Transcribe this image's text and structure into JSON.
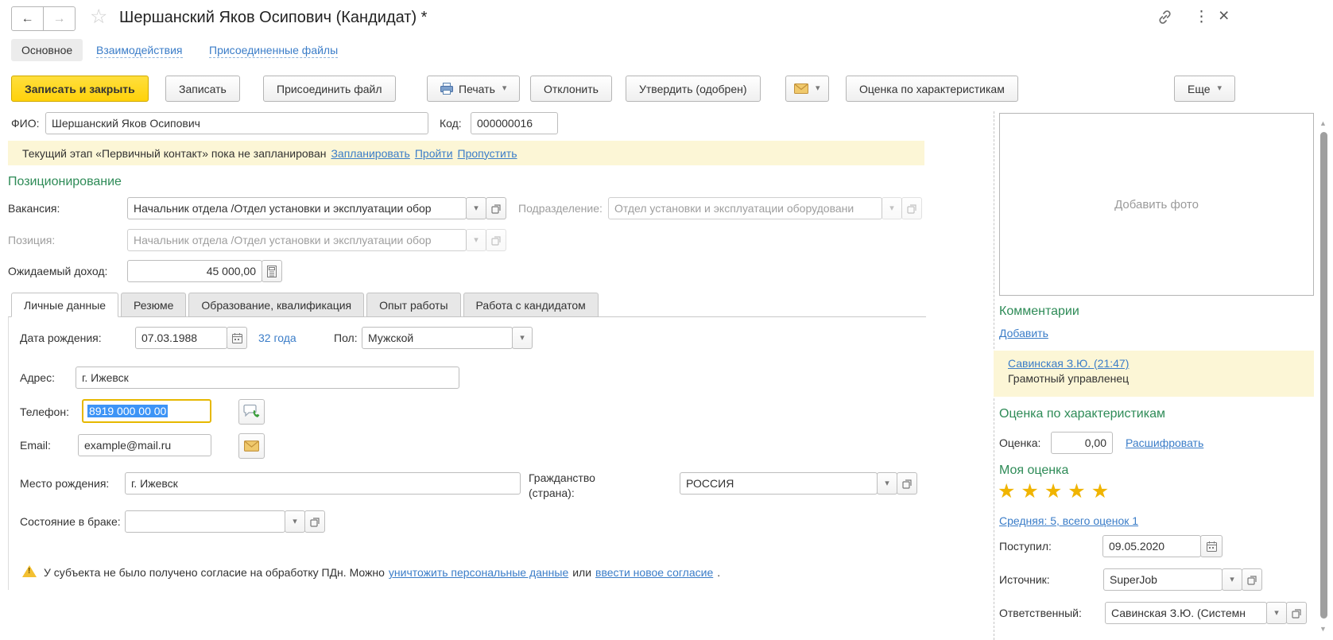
{
  "header": {
    "title": "Шершанский Яков Осипович (Кандидат) *"
  },
  "nav": {
    "main": "Основное",
    "interactions": "Взаимодействия",
    "attachments": "Присоединенные файлы"
  },
  "toolbar": {
    "save_and_close": "Записать и закрыть",
    "save": "Записать",
    "attach_file": "Присоединить файл",
    "print": "Печать",
    "reject": "Отклонить",
    "approve": "Утвердить (одобрен)",
    "characteristics_rating": "Оценка по характеристикам",
    "more": "Еще"
  },
  "identity": {
    "fio_label": "ФИО:",
    "fio_value": "Шершанский Яков Осипович",
    "code_label": "Код:",
    "code_value": "000000016"
  },
  "stage_notice": {
    "text": "Текущий этап «Первичный контакт» пока не запланирован",
    "plan_link": "Запланировать",
    "pass_link": "Пройти",
    "skip_link": "Пропустить"
  },
  "positioning": {
    "heading": "Позиционирование",
    "vacancy_label": "Вакансия:",
    "vacancy_value": "Начальник отдела /Отдел установки и эксплуатации обор",
    "department_label": "Подразделение:",
    "department_value": "Отдел установки и эксплуатации оборудовани",
    "position_label": "Позиция:",
    "position_value": "Начальник отдела /Отдел установки и эксплуатации обор",
    "expected_income_label": "Ожидаемый доход:",
    "expected_income_value": "45 000,00"
  },
  "tabs": {
    "personal": "Личные данные",
    "resume": "Резюме",
    "education": "Образование, квалификация",
    "experience": "Опыт работы",
    "work_with_candidate": "Работа с кандидатом"
  },
  "personal": {
    "birth_date_label": "Дата рождения:",
    "birth_date_value": "07.03.1988",
    "age_link": "32 года",
    "gender_label": "Пол:",
    "gender_value": "Мужской",
    "address_label": "Адрес:",
    "address_value": "г. Ижевск",
    "phone_label": "Телефон:",
    "phone_value": "8919 000 00 00",
    "email_label": "Email:",
    "email_value": "example@mail.ru",
    "birth_place_label": "Место рождения:",
    "birth_place_value": "г. Ижевск",
    "citizenship_label": "Гражданство (страна):",
    "citizenship_value": "РОССИЯ",
    "marital_label": "Состояние в браке:",
    "marital_value": ""
  },
  "consent_warning": {
    "text_before": "У субъекта не было получено согласие на обработку ПДн. Можно",
    "destroy_link": "уничтожить персональные данные",
    "text_middle": "или",
    "new_consent_link": "ввести новое согласие",
    "text_after": "."
  },
  "right_panel": {
    "add_photo": "Добавить фото",
    "comments_heading": "Комментарии",
    "add_comment_link": "Добавить",
    "comment_author": "Савинская З.Ю. (21:47)",
    "comment_text": "Грамотный управленец",
    "rating_heading": "Оценка по характеристикам",
    "rating_label": "Оценка:",
    "rating_value": "0,00",
    "decrypt_link": "Расшифровать",
    "my_rating_heading": "Моя оценка",
    "average_link": "Средняя: 5, всего оценок 1",
    "received_label": "Поступил:",
    "received_value": "09.05.2020",
    "source_label": "Источник:",
    "source_value": "SuperJob",
    "responsible_label": "Ответственный:",
    "responsible_value": "Савинская З.Ю. (Системн"
  },
  "icons": {
    "back_arrow": "←",
    "forward_arrow": "→",
    "favorite_star": "☆",
    "kebab": "⋮",
    "close": "×",
    "star": "★",
    "caret": "▾",
    "scroll_up": "▲",
    "scroll_down": "▼"
  },
  "colors": {
    "accent_green": "#2e8b57",
    "link_blue": "#3b7dc8",
    "primary_button_yellow": "#ffd20a",
    "notice_bg": "#fcf6d6",
    "focus_border_gold": "#e6b800",
    "star_gold": "#f0b400",
    "selection_blue": "#3d94f6"
  }
}
